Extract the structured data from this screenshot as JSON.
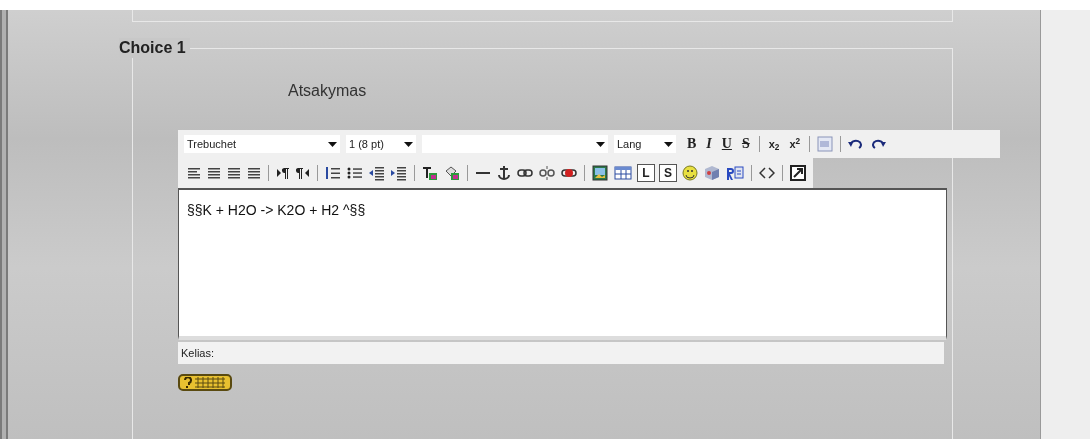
{
  "fieldset": {
    "legend": "Choice 1"
  },
  "field_label": "Atsakymas",
  "editor": {
    "font_select": "Trebuchet",
    "size_select": "1 (8 pt)",
    "lang_select": "Lang",
    "format_buttons": [
      {
        "label": "B",
        "kind": "bold"
      },
      {
        "label": "I",
        "kind": "italic"
      },
      {
        "label": "U",
        "kind": "underline"
      },
      {
        "label": "S",
        "kind": "strike"
      }
    ],
    "script_buttons": [
      "x$_{2}$",
      "x$^{2}$"
    ],
    "insert_buttons": [
      "L",
      "S"
    ],
    "content": "§§K + H2O -> K2O + H2 ^§§",
    "path_label": "Kelias:"
  }
}
